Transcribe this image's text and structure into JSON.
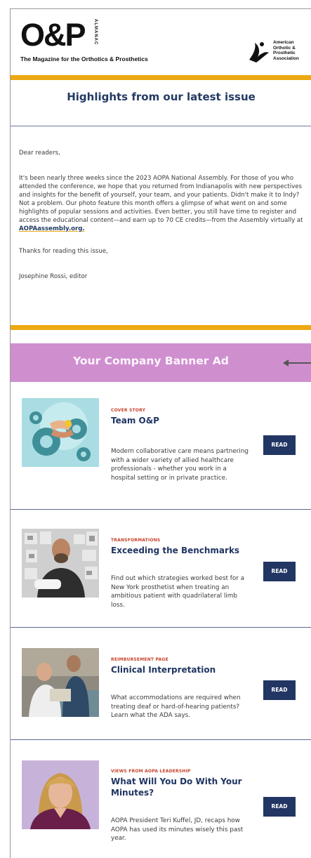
{
  "header": {
    "logo": "O&P",
    "logo_vertical": "ALMANAC",
    "tagline": "The Magazine for the Orthotics & Prosthetics",
    "org_lines": [
      "American",
      "Orthotic &",
      "Prosthetic",
      "Association"
    ]
  },
  "highlights_title": "Highlights from our latest issue",
  "letter": {
    "salutation": "Dear readers,",
    "body": "It's been nearly three weeks since the 2023 AOPA National Assembly. For those of you who attended the conference, we hope that you returned from Indianapolis with new perspectives and insights for the benefit of yourself, your team, and your patients. Didn't make it to Indy? Not a problem. Our photo feature this month offers a glimpse of what went on and some highlights of popular sessions and activities. Even better, you still have time to register and access the educational content—and earn up to 70 CE credits—from the Assembly virtually at ",
    "link": "AOPAassembly.org.",
    "closing": "Thanks for reading this issue,",
    "signature": "Josephine Rossi, editor"
  },
  "banner": {
    "text": "Your Company Banner Ad"
  },
  "articles": [
    {
      "kicker": "COVER STORY",
      "title": "Team O&P",
      "desc": "Modern collaborative care means partnering with a wider variety of allied healthcare professionals - whether you work in a hospital setting or in private practice.",
      "button": "READ",
      "thumb_icon": "gears-handshake-illustration"
    },
    {
      "kicker": "TRANSFORMATIONS",
      "title": "Exceeding the Benchmarks",
      "desc": "Find out which strategies worked best for a New York prosthetist when treating an ambitious patient with quadrilateral limb loss.",
      "button": "READ",
      "thumb_icon": "prosthetist-photo"
    },
    {
      "kicker": "REIMBURSEMENT PAGE",
      "title": "Clinical Interpretation",
      "desc": "What accommodations are required when treating deaf or hard-of-hearing patients? Learn what the ADA says.",
      "button": "READ",
      "thumb_icon": "patients-photo"
    },
    {
      "kicker": "VIEWS FROM AOPA LEADERSHIP",
      "title": "What Will You Do With Your Minutes?",
      "desc": "AOPA President Teri Kuffel, JD, recaps how AOPA has used its minutes wisely this past year.",
      "button": "READ",
      "thumb_icon": "president-portrait"
    }
  ],
  "colors": {
    "accent_gold": "#eca912",
    "navy": "#223663",
    "kicker_red": "#c7432b",
    "banner_pink": "#cf8fcf"
  }
}
